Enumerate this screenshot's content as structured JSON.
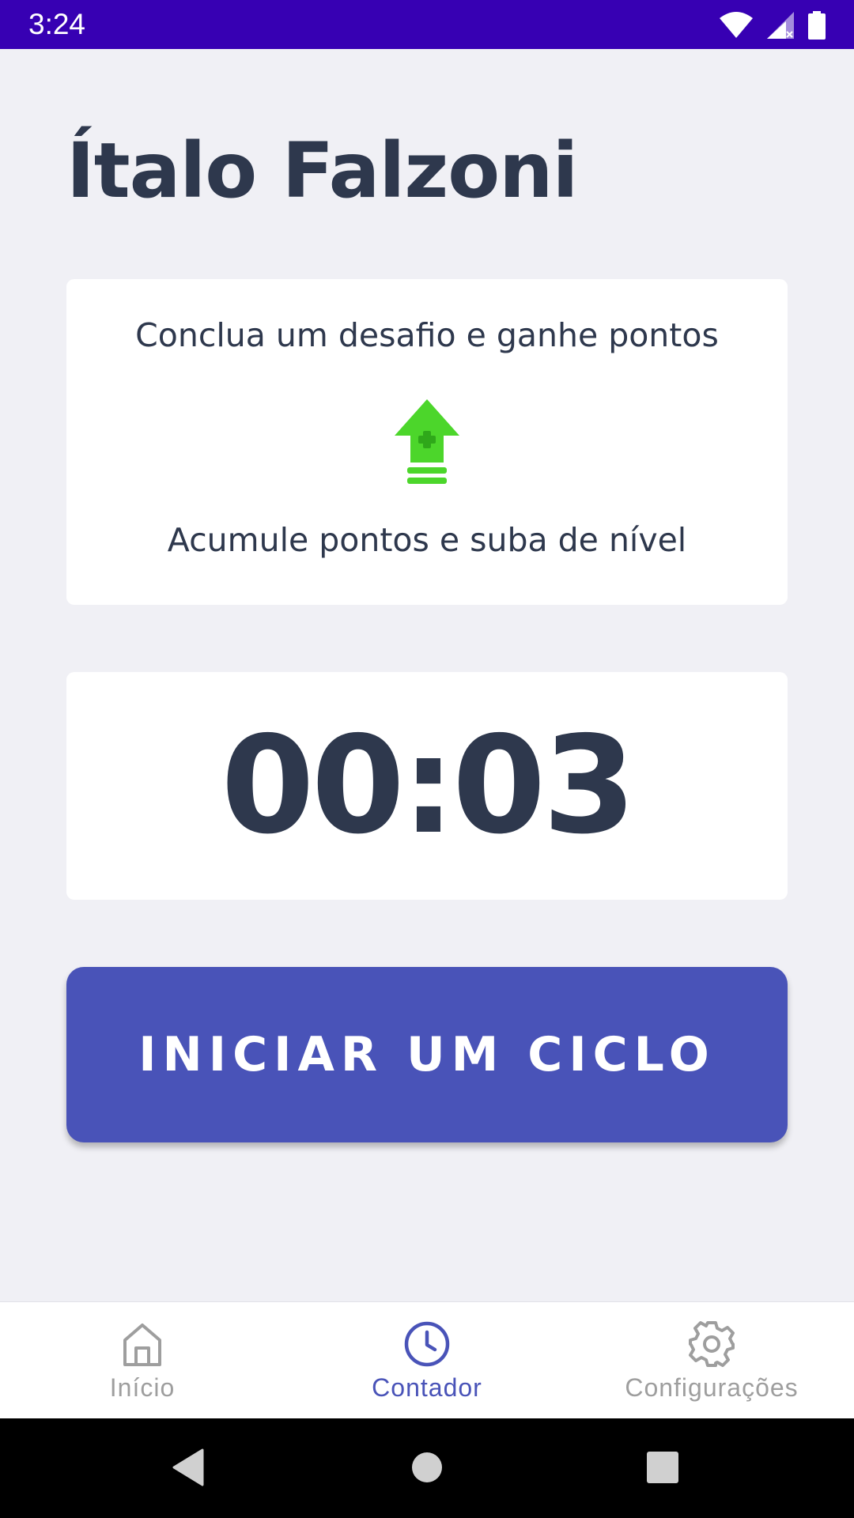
{
  "status_bar": {
    "time": "3:24"
  },
  "header": {
    "title": "Ítalo Falzoni"
  },
  "info_card": {
    "top_text": "Conclua um desafio e ganhe pontos",
    "icon": "level-up-icon",
    "bottom_text": "Acumule pontos e suba de nível",
    "icon_color": "#4cd62b"
  },
  "timer": {
    "value": "00:03"
  },
  "cta": {
    "label": "INICIAR UM CICLO",
    "color": "#4953b8"
  },
  "bottom_nav": {
    "items": [
      {
        "label": "Início",
        "icon": "home-icon",
        "active": false
      },
      {
        "label": "Contador",
        "icon": "clock-icon",
        "active": true
      },
      {
        "label": "Configurações",
        "icon": "gear-icon",
        "active": false
      }
    ],
    "active_color": "#4953b8",
    "inactive_color": "#9e9e9e"
  },
  "colors": {
    "status_bar": "#3700b3",
    "background": "#f0f0f5",
    "text": "#2e384d"
  }
}
